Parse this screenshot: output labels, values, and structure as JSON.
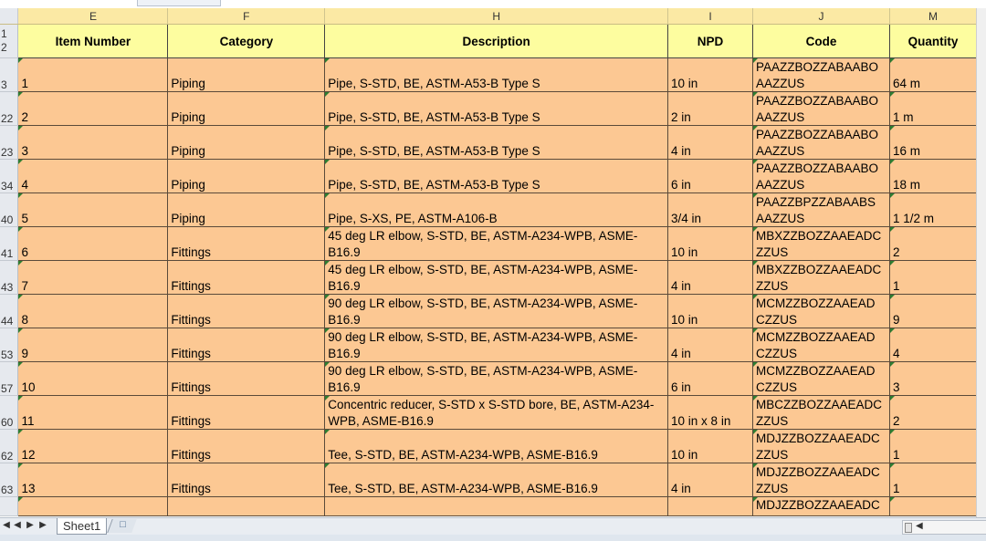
{
  "columns": [
    "E",
    "F",
    "H",
    "I",
    "J",
    "M"
  ],
  "headers": {
    "row_labels": [
      "1",
      "2"
    ],
    "cells": [
      "Item Number",
      "Category",
      "Description",
      "NPD",
      "Code",
      "Quantity"
    ]
  },
  "rows": [
    {
      "row": "3",
      "item": "1",
      "category": "Piping",
      "description": "Pipe, S-STD, BE, ASTM-A53-B Type S",
      "npd": "10 in",
      "code": "PAAZZBOZZABAABO AAZZUS",
      "qty": "64 m"
    },
    {
      "row": "22",
      "item": "2",
      "category": "Piping",
      "description": "Pipe, S-STD, BE, ASTM-A53-B Type S",
      "npd": "2 in",
      "code": "PAAZZBOZZABAABO AAZZUS",
      "qty": "1 m"
    },
    {
      "row": "23",
      "item": "3",
      "category": "Piping",
      "description": "Pipe, S-STD, BE, ASTM-A53-B Type S",
      "npd": "4 in",
      "code": "PAAZZBOZZABAABO AAZZUS",
      "qty": "16 m"
    },
    {
      "row": "34",
      "item": "4",
      "category": "Piping",
      "description": "Pipe, S-STD, BE, ASTM-A53-B Type S",
      "npd": "6 in",
      "code": "PAAZZBOZZABAABO AAZZUS",
      "qty": "18 m"
    },
    {
      "row": "40",
      "item": "5",
      "category": "Piping",
      "description": "Pipe, S-XS, PE, ASTM-A106-B",
      "npd": "3/4 in",
      "code": "PAAZZBPZZABAABS AAZZUS",
      "qty": "1 1/2 m"
    },
    {
      "row": "41",
      "item": "6",
      "category": "Fittings",
      "description": "45 deg LR elbow, S-STD, BE, ASTM-A234-WPB, ASME-B16.9",
      "npd": "10 in",
      "code": "MBXZZBOZZAAEADC ZZUS",
      "qty": "2"
    },
    {
      "row": "43",
      "item": "7",
      "category": "Fittings",
      "description": "45 deg LR elbow, S-STD, BE, ASTM-A234-WPB, ASME-B16.9",
      "npd": "4 in",
      "code": "MBXZZBOZZAAEADC ZZUS",
      "qty": "1"
    },
    {
      "row": "44",
      "item": "8",
      "category": "Fittings",
      "description": "90 deg LR elbow, S-STD, BE, ASTM-A234-WPB, ASME-B16.9",
      "npd": "10 in",
      "code": "MCMZZBOZZAAEAD CZZUS",
      "qty": "9"
    },
    {
      "row": "53",
      "item": "9",
      "category": "Fittings",
      "description": "90 deg LR elbow, S-STD, BE, ASTM-A234-WPB, ASME-B16.9",
      "npd": "4 in",
      "code": "MCMZZBOZZAAEAD CZZUS",
      "qty": "4"
    },
    {
      "row": "57",
      "item": "10",
      "category": "Fittings",
      "description": "90 deg LR elbow, S-STD, BE, ASTM-A234-WPB, ASME-B16.9",
      "npd": "6 in",
      "code": "MCMZZBOZZAAEAD CZZUS",
      "qty": "3"
    },
    {
      "row": "60",
      "item": "11",
      "category": "Fittings",
      "description": "Concentric reducer, S-STD x S-STD bore, BE, ASTM-A234-WPB, ASME-B16.9",
      "npd": "10 in x 8 in",
      "code": "MBCZZBOZZAAEADC ZZUS",
      "qty": "2"
    },
    {
      "row": "62",
      "item": "12",
      "category": "Fittings",
      "description": "Tee, S-STD, BE, ASTM-A234-WPB, ASME-B16.9",
      "npd": "10 in",
      "code": "MDJZZBOZZAAEADC ZZUS",
      "qty": "1"
    },
    {
      "row": "63",
      "item": "13",
      "category": "Fittings",
      "description": "Tee, S-STD, BE, ASTM-A234-WPB, ASME-B16.9",
      "npd": "4 in",
      "code": "MDJZZBOZZAAEADC ZZUS",
      "qty": "1"
    }
  ],
  "partial_row": {
    "code": "MDJZZBOZZAAEADC"
  },
  "sheet_tab": "Sheet1",
  "colors": {
    "header_fill": "#fdfd9f",
    "data_fill": "#fcc893",
    "column_header_fill": "#fbe9a4"
  }
}
